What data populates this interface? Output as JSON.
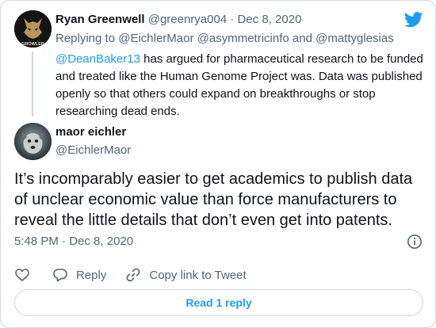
{
  "parent_tweet": {
    "display_name": "Ryan Greenwell",
    "handle": "@greenrya004",
    "separator": "·",
    "date": "Dec 8, 2020",
    "avatar_text": "GROWLER",
    "replying_prefix": "Replying to",
    "replying_handles": "@EichlerMaor @asymmetricinfo",
    "replying_and": "and",
    "replying_last": "@mattyglesias",
    "mention": "@DeanBaker13",
    "text": " has argued for pharmaceutical research to be funded and treated like the Human Genome Project was. Data was published openly so that others could expand on breakthroughs or stop researching dead ends."
  },
  "main_tweet": {
    "display_name": "maor eichler",
    "handle": "@EichlerMaor",
    "text": "It’s incomparably easier to get academics to publish data of unclear economic value than force manufacturers to reveal the little details that don’t even get into patents.",
    "time": "5:48 PM",
    "separator": "·",
    "date": "Dec 8, 2020"
  },
  "actions": {
    "reply_label": "Reply",
    "copy_label": "Copy link to Tweet",
    "read_replies_label": "Read 1 reply"
  },
  "colors": {
    "accent": "#1d9bf0",
    "muted": "#536471",
    "border": "#cfd9de"
  },
  "icons": [
    "twitter-bird-icon",
    "info-icon",
    "heart-icon",
    "reply-icon",
    "link-icon"
  ]
}
